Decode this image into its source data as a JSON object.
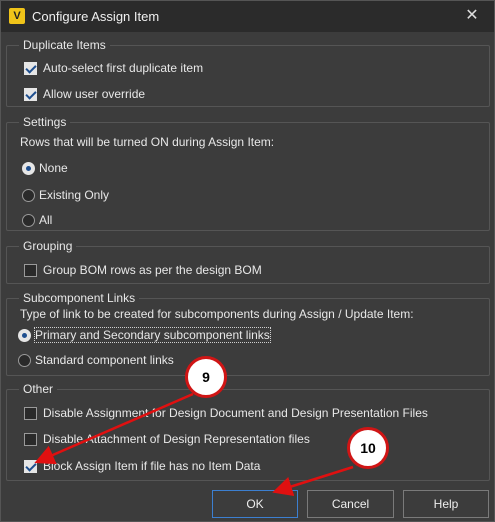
{
  "window": {
    "title": "Configure Assign Item",
    "app_icon_letter": "V",
    "close_glyph": "✕"
  },
  "groups": {
    "duplicate": {
      "legend": "Duplicate Items",
      "items": [
        {
          "label": "Auto-select first duplicate item",
          "checked": true
        },
        {
          "label": "Allow user override",
          "checked": true
        }
      ]
    },
    "settings": {
      "legend": "Settings",
      "prompt": "Rows that will be turned ON during Assign Item:",
      "options": [
        {
          "label": "None",
          "selected": true
        },
        {
          "label": "Existing Only",
          "selected": false
        },
        {
          "label": "All",
          "selected": false
        }
      ]
    },
    "grouping": {
      "legend": "Grouping",
      "items": [
        {
          "label": "Group BOM rows as per the design BOM",
          "checked": false
        }
      ]
    },
    "subcomponent": {
      "legend": "Subcomponent Links",
      "prompt": "Type of link to be created for subcomponents during Assign / Update Item:",
      "options": [
        {
          "label": "Primary and Secondary subcomponent links",
          "selected": true
        },
        {
          "label": "Standard component links",
          "selected": false
        }
      ]
    },
    "other": {
      "legend": "Other",
      "items": [
        {
          "label": "Disable Assignment for Design Document and Design Presentation Files",
          "checked": false
        },
        {
          "label": "Disable Attachment of Design Representation files",
          "checked": false
        },
        {
          "label": "Block Assign Item if file has no Item Data",
          "checked": true
        }
      ]
    }
  },
  "buttons": {
    "ok": "OK",
    "cancel": "Cancel",
    "help": "Help"
  },
  "callouts": {
    "first": "9",
    "second": "10"
  },
  "colors": {
    "callout_border": "#d01515",
    "arrow": "#e01010",
    "accent": "#3c7fd0"
  }
}
